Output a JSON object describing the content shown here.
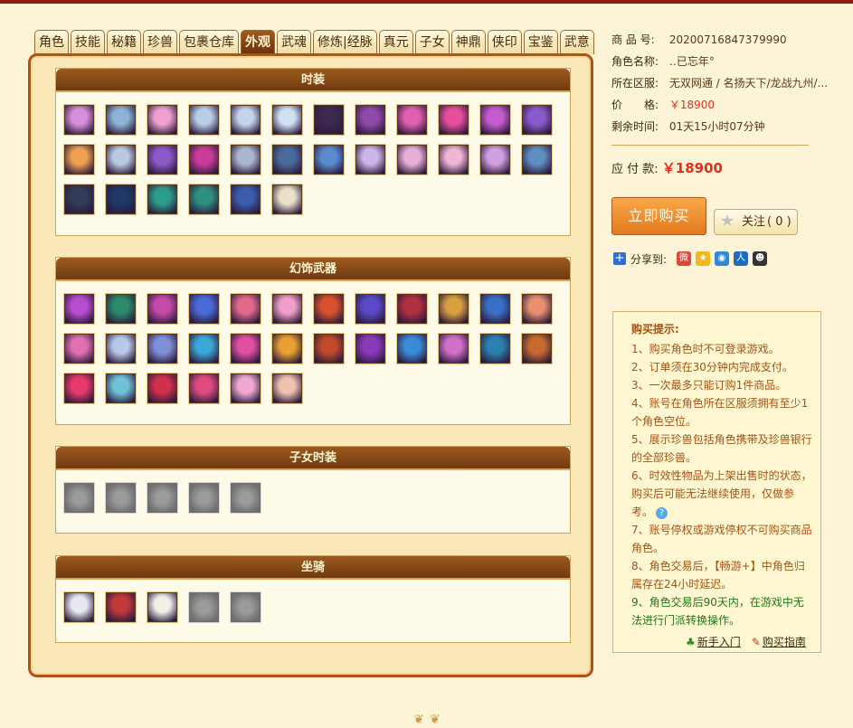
{
  "tabs": [
    "角色",
    "技能",
    "秘籍",
    "珍兽",
    "包裹仓库",
    "外观",
    "武魂",
    "修炼|经脉",
    "真元",
    "子女",
    "神鼎",
    "侠印",
    "宝鉴",
    "武意"
  ],
  "active_tab": "外观",
  "sections": {
    "fashion": {
      "title": "时装",
      "colors": [
        "#d68fd8",
        "#8fb3d8",
        "#f0a0d0",
        "#b8cde6",
        "#c4d4ea",
        "#cfe2f4",
        "#3b2a4e",
        "#8e4aa8",
        "#e05fb0",
        "#e74f9b",
        "#c55bd0",
        "#8a5acb",
        "#f0a050",
        "#b9c9e0",
        "#8d58c8",
        "#c83c9a",
        "#a9b8d1",
        "#4b6b9c",
        "#5a8bd0",
        "#ccb5e8",
        "#e8b0d8",
        "#f0b4d4",
        "#d2a0e0",
        "#5f8ec0",
        "#323c58",
        "#1f3868",
        "#2c9c8c",
        "#2f8f80",
        "#3c5cae",
        "#e8e0c8"
      ]
    },
    "weapons": {
      "title": "幻饰武器",
      "colors": [
        "#b84cd0",
        "#2a8a6a",
        "#c24aa8",
        "#4a6ad8",
        "#e06a8a",
        "#f0a0c8",
        "#d85030",
        "#5a4ac8",
        "#b03040",
        "#d8a040",
        "#3870c8",
        "#e89070",
        "#e070b0",
        "#b8c8e8",
        "#8090d8",
        "#3ca8d8",
        "#e050a0",
        "#e8a030",
        "#c04a2a",
        "#8a3ab8",
        "#3a8ad8",
        "#d070c8",
        "#2c80b0",
        "#c86a30",
        "#e83a6a",
        "#70c0d8",
        "#d0304a",
        "#e04a80",
        "#f0a8d0",
        "#f0c0b0"
      ]
    },
    "children": {
      "title": "子女时装",
      "slots": 5
    },
    "mounts": {
      "title": "坐骑",
      "colors": [
        "#e8e8f0",
        "#c03a3a",
        "#f0f0e8"
      ],
      "empty_slots": 2
    }
  },
  "info": {
    "item_no_label": "商 品 号:",
    "item_no": "20200716847379990",
    "role_label": "角色名称:",
    "role_name": "‥已忘年°",
    "server_label": "所在区服:",
    "server": "无双网通 / 名扬天下/龙战九州/...",
    "price_label": "价　　格:",
    "price": "￥18900",
    "time_label": "剩余时间:",
    "time_left": "01天15小时07分钟",
    "pay_label": "应 付 款:",
    "pay_amount": "￥18900"
  },
  "buy_button": "立即购买",
  "follow": {
    "label": "关注",
    "count": "( 0 )"
  },
  "share": {
    "label": "分享到:",
    "icons": [
      "weibo-icon",
      "qzone-icon",
      "tencent-weibo-icon",
      "renren-icon",
      "qq-icon"
    ]
  },
  "tips": {
    "title": "购买提示:",
    "items": [
      "1、购买角色时不可登录游戏。",
      "2、订单须在30分钟内完成支付。",
      "3、一次最多只能订购1件商品。",
      "4、账号在角色所在区服须拥有至少1个角色空位。",
      "5、展示珍兽包括角色携带及珍兽银行的全部珍兽。",
      "6、时效性物品为上架出售时的状态，购买后可能无法继续使用，仅做参考。",
      "7、账号停权或游戏停权不可购买商品角色。",
      "8、角色交易后，【畅游+】中角色归属存在24小时延迟。",
      "9、角色交易后90天内，在游戏中无法进行门派转换操作。"
    ],
    "links": [
      "新手入门",
      "购买指南"
    ]
  }
}
